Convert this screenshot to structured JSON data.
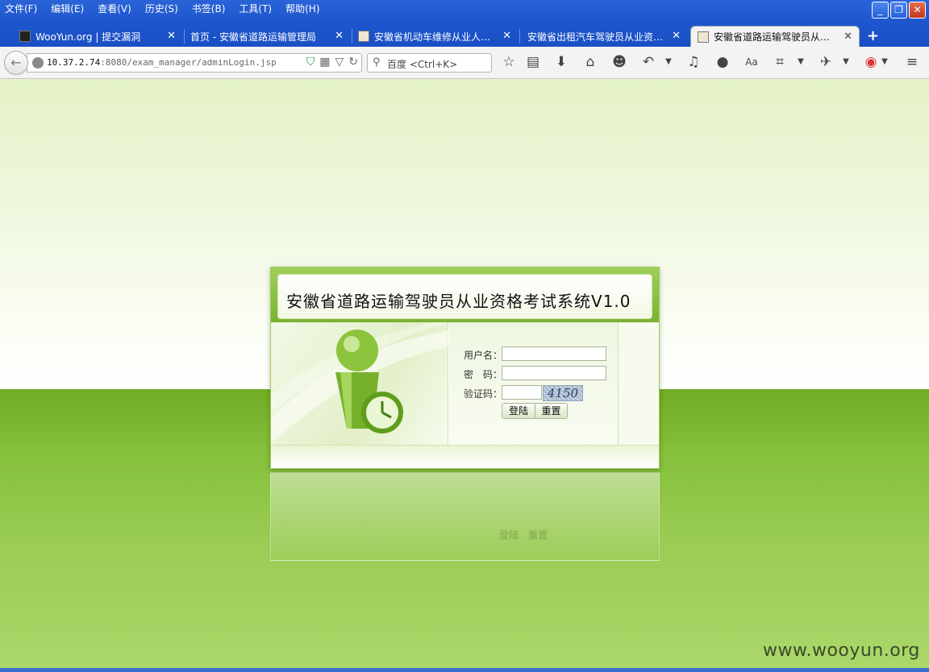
{
  "window": {
    "menu": [
      "文件(F)",
      "编辑(E)",
      "查看(V)",
      "历史(S)",
      "书签(B)",
      "工具(T)",
      "帮助(H)"
    ],
    "controls": {
      "minimize": "_",
      "restore": "❐",
      "close": "✕"
    }
  },
  "tabs": [
    {
      "label": "WooYun.org | 提交漏洞",
      "active": false
    },
    {
      "label": "首页 - 安徽省道路运输管理局",
      "active": false
    },
    {
      "label": "安徽省机动车维修从业人…",
      "active": false
    },
    {
      "label": "安徽省出租汽车驾驶员从业资…",
      "active": false
    },
    {
      "label": "安徽省道路运输驾驶员从…",
      "active": true
    }
  ],
  "tab_close": "✕",
  "new_tab": "+",
  "navbar": {
    "back": "←",
    "url_host": "10.37.2.74",
    "url_rest": ":8080/exam_manager/adminLogin.jsp",
    "search_placeholder": "百度 <Ctrl+K>",
    "icons": {
      "shield": "shield-icon",
      "qr": "qr-icon",
      "reload": "reload-icon",
      "star": "star-icon",
      "reading": "reading-list-icon",
      "download": "download-icon",
      "home": "home-icon",
      "smiley": "smiley-icon",
      "undo": "undo-icon",
      "volume": "volume-icon",
      "chat": "chat-icon",
      "aa": "font-icon",
      "crop": "crop-icon",
      "hamburger": "menu-icon"
    }
  },
  "login": {
    "title": "安徽省道路运输驾驶员从业资格考试系统V1.0",
    "username_label": "用户名：",
    "password_label": "密　码：",
    "captcha_label": "验证码：",
    "username_value": "",
    "password_value": "",
    "captcha_value": "",
    "captcha_text": "4150",
    "login_button": "登陆",
    "reset_button": "重置"
  },
  "reflection": {
    "text": "登陆　重置"
  },
  "watermark": "www.wooyun.org",
  "colors": {
    "accent_green": "#7ab232",
    "chrome_blue": "#1d55cc"
  }
}
